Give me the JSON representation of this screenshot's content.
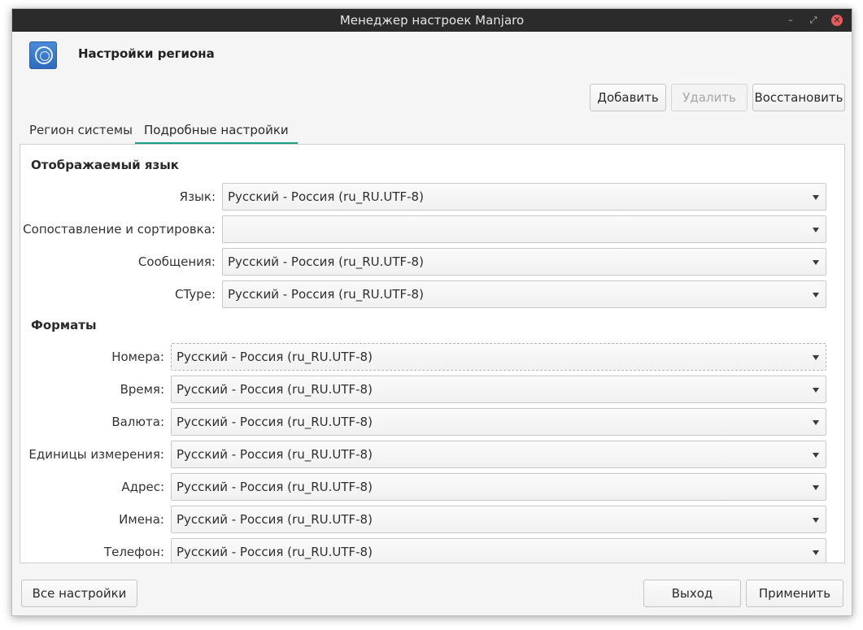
{
  "window": {
    "title": "Менеджер настроек Manjaro",
    "controls": {
      "minimize": "–",
      "restore": "⤢",
      "close": "✕"
    }
  },
  "header": {
    "title": "Настройки региона",
    "icon": "region-globe-icon"
  },
  "toolbar": {
    "add_label": "Добавить",
    "remove_label": "Удалить",
    "restore_label": "Восстановить"
  },
  "tabs": [
    {
      "label": "Регион системы",
      "active": false
    },
    {
      "label": "Подробные настройки",
      "active": true
    }
  ],
  "display_language": {
    "section_title": "Отображаемый язык",
    "rows": [
      {
        "label": "Язык:",
        "value": "Русский - Россия (ru_RU.UTF-8)"
      },
      {
        "label": "Сопоставление и сортировка:",
        "value": ""
      },
      {
        "label": "Сообщения:",
        "value": "Русский - Россия (ru_RU.UTF-8)"
      },
      {
        "label": "CType:",
        "value": "Русский - Россия (ru_RU.UTF-8)"
      }
    ]
  },
  "formats": {
    "section_title": "Форматы",
    "rows": [
      {
        "label": "Номера:",
        "value": "Русский - Россия (ru_RU.UTF-8)"
      },
      {
        "label": "Время:",
        "value": "Русский - Россия (ru_RU.UTF-8)"
      },
      {
        "label": "Валюта:",
        "value": "Русский - Россия (ru_RU.UTF-8)"
      },
      {
        "label": "Единицы измерения:",
        "value": "Русский - Россия (ru_RU.UTF-8)"
      },
      {
        "label": "Адрес:",
        "value": "Русский - Россия (ru_RU.UTF-8)"
      },
      {
        "label": "Имена:",
        "value": "Русский - Россия (ru_RU.UTF-8)"
      },
      {
        "label": "Телефон:",
        "value": "Русский - Россия (ru_RU.UTF-8)"
      }
    ]
  },
  "footer": {
    "all_settings_label": "Все настройки",
    "quit_label": "Выход",
    "apply_label": "Применить"
  },
  "colors": {
    "accent": "#16a085",
    "titlebar": "#2b2b2b",
    "close": "#e35b5b"
  }
}
